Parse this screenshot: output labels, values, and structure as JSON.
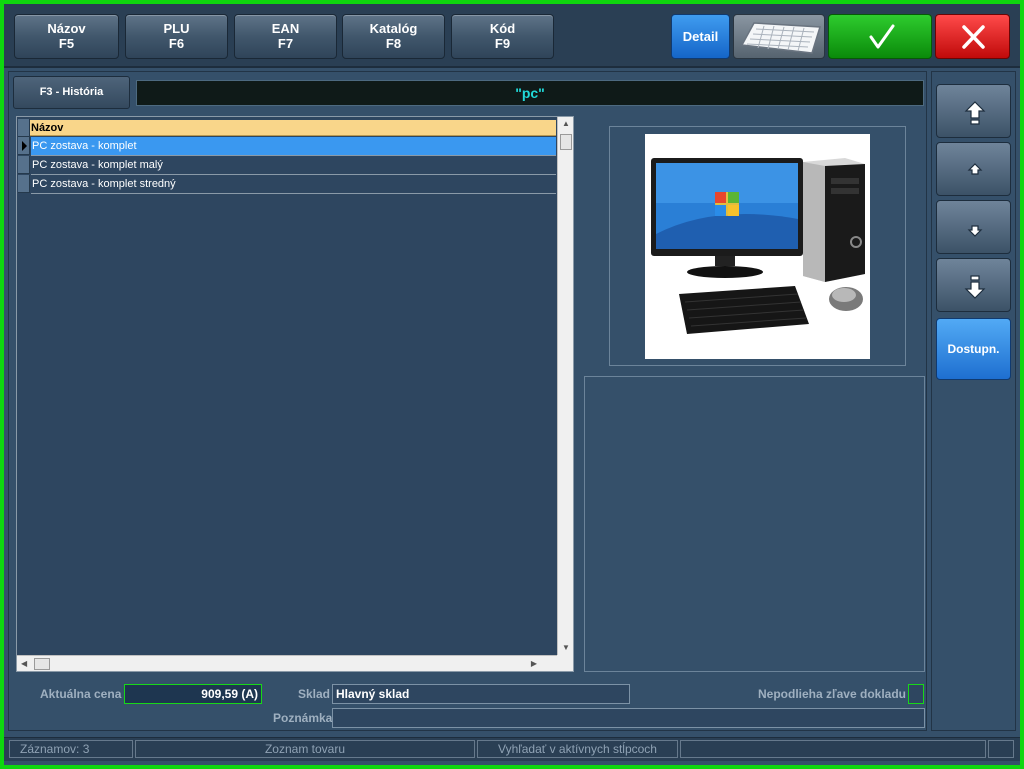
{
  "toolbar": {
    "buttons": [
      {
        "label": "Názov",
        "key": "F5"
      },
      {
        "label": "PLU",
        "key": "F6"
      },
      {
        "label": "EAN",
        "key": "F7"
      },
      {
        "label": "Katalóg",
        "key": "F8"
      },
      {
        "label": "Kód",
        "key": "F9"
      }
    ],
    "detail_label": "Detail",
    "keyboard_icon": "keyboard-icon",
    "confirm_icon": "checkmark-icon",
    "cancel_icon": "close-icon"
  },
  "history_tab": "F3 - História",
  "search_value": "\"pc\"",
  "grid": {
    "column_header": "Názov",
    "rows": [
      {
        "name": "PC zostava - komplet",
        "selected": true
      },
      {
        "name": "PC zostava - komplet malý",
        "selected": false
      },
      {
        "name": "PC zostava - komplet stredný",
        "selected": false
      }
    ]
  },
  "details": {
    "price_label": "Aktuálna cena",
    "price_value": "909,59 (A)",
    "warehouse_label": "Sklad",
    "warehouse_value": "Hlavný sklad",
    "discount_label": "Nepodlieha zľave dokladu",
    "note_label": "Poznámka",
    "note_value": ""
  },
  "sidebar": {
    "available_label": "Dostupn."
  },
  "statusbar": {
    "records": "Záznamov: 3",
    "list_name": "Zoznam tovaru",
    "search_mode": "Vyhľadať v aktívnych stĺpcoch"
  },
  "colors": {
    "frame": "#0fd60f",
    "background": "#35506a",
    "selected_row": "#3a98f0",
    "header_row": "#f9d68a",
    "search_text": "#21d9d9"
  }
}
